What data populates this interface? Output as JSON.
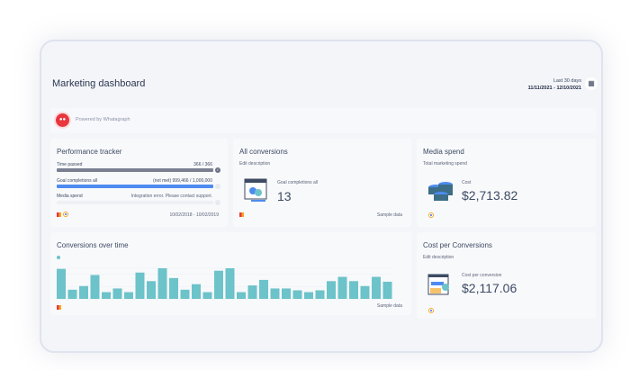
{
  "header": {
    "title": "Marketing dashboard",
    "range_label": "Last 30 days",
    "range_dates": "11/11/2021 - 12/10/2021",
    "calendar_icon": "calendar-icon"
  },
  "powered": {
    "text": "Powered by Whatagraph"
  },
  "performance": {
    "title": "Performance tracker",
    "rows": [
      {
        "label": "Time passed",
        "value": "366 / 366",
        "progress": 1.0
      },
      {
        "label": "Goal completions all",
        "value": "(not met) 999,466 / 1,000,000",
        "progress": 0.9995
      },
      {
        "label": "Media spend",
        "value": "Integration error. Please contact support.",
        "progress": 0
      }
    ],
    "dates": "10/02/2018 - 10/02/2019"
  },
  "all_conversions": {
    "title": "All conversions",
    "description": "Edit description",
    "metric_label": "Goal completions all",
    "value": "13",
    "footer": "Sample data"
  },
  "media_spend": {
    "title": "Media spend",
    "description": "Total marketing spend",
    "metric_label": "Cost",
    "value": "$2,713.82"
  },
  "conversions_over_time": {
    "title": "Conversions over time",
    "footer": "Sample data",
    "bar_color": "#6cc3c9"
  },
  "cost_per_conversion": {
    "title": "Cost per Conversions",
    "description": "Edit description",
    "metric_label": "Cost per conversion",
    "value": "$2,117.06"
  },
  "chart_data": {
    "type": "bar",
    "values": [
      49,
      15,
      21,
      39,
      11,
      17,
      11,
      43,
      29,
      50,
      34,
      15,
      24,
      11,
      46,
      50,
      11,
      22,
      31,
      17,
      17,
      14,
      11,
      14,
      29,
      36,
      29,
      21,
      36,
      28
    ],
    "ylim": [
      0,
      50
    ],
    "grid": true
  }
}
